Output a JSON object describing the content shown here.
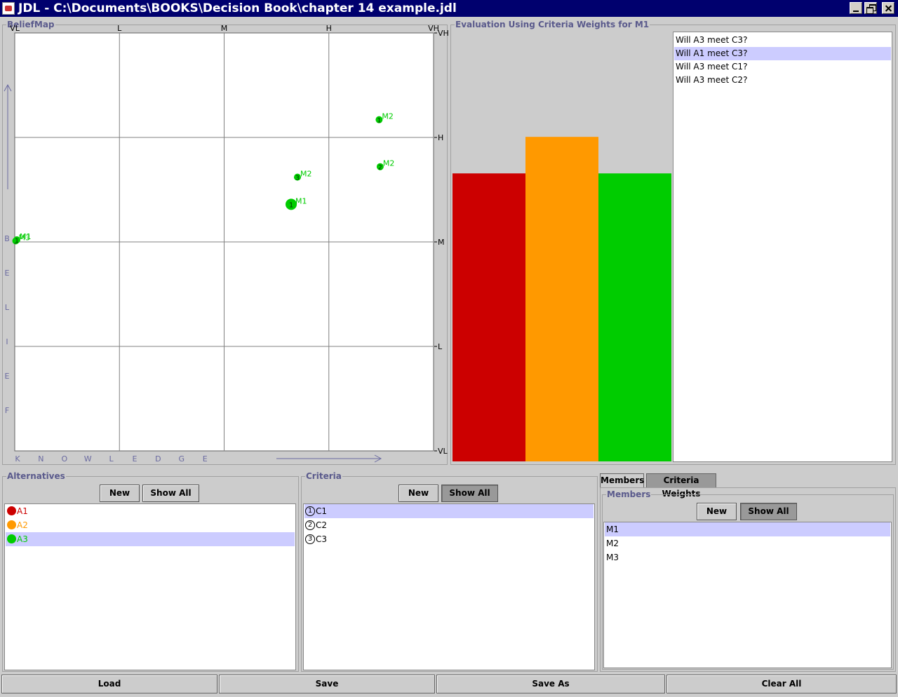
{
  "window": {
    "title": "JDL - C:\\Documents\\BOOKS\\Decision Book\\chapter 14 example.jdl"
  },
  "belief_map": {
    "title": "BeliefMap",
    "x_ticks": [
      "VL",
      "L",
      "M",
      "H",
      "VH"
    ],
    "y_ticks_right": [
      "VH",
      "H",
      "M",
      "L",
      "VL"
    ],
    "x_axis_letters": [
      "K",
      "N",
      "O",
      "W",
      "L",
      "E",
      "D",
      "G",
      "E"
    ],
    "y_axis_letters": [
      "B",
      "E",
      "L",
      "I",
      "E",
      "F"
    ],
    "colors": {
      "point": "#00cc00",
      "grid": "#808080",
      "axis_label": "#6a6aa0"
    },
    "points": [
      {
        "x": 3.48,
        "y": 3.17,
        "criterion": "1",
        "member": "M2"
      },
      {
        "x": 3.49,
        "y": 2.72,
        "criterion": "2",
        "member": "M2"
      },
      {
        "x": 2.7,
        "y": 2.62,
        "criterion": "3",
        "member": "M2"
      },
      {
        "x": 2.64,
        "y": 2.36,
        "criterion": "1",
        "member": "M1"
      },
      {
        "x": 0.01,
        "y": 2.01,
        "criterion": "3",
        "member": "M3"
      },
      {
        "x": 0.02,
        "y": 2.02,
        "criterion": "1",
        "member": "M1"
      }
    ]
  },
  "evaluation": {
    "title": "Evaluation Using Criteria Weights for M1",
    "chart_data": {
      "type": "bar",
      "categories": [
        "A1",
        "A2",
        "A3"
      ],
      "values": [
        0.67,
        0.755,
        0.67
      ],
      "colors": [
        "#cc0000",
        "#ff9900",
        "#00cc00"
      ],
      "ylim": [
        0,
        1
      ]
    },
    "questions": [
      {
        "text": "Will A3 meet C3?",
        "selected": false
      },
      {
        "text": "Will A1 meet C3?",
        "selected": true
      },
      {
        "text": "Will A3 meet C1?",
        "selected": false
      },
      {
        "text": "Will A3 meet C2?",
        "selected": false
      }
    ]
  },
  "alternatives": {
    "title": "Alternatives",
    "new_label": "New",
    "show_all_label": "Show All",
    "items": [
      {
        "label": "A1",
        "color": "#cc0000"
      },
      {
        "label": "A2",
        "color": "#ff9900"
      },
      {
        "label": "A3",
        "color": "#00cc00"
      }
    ]
  },
  "criteria": {
    "title": "Criteria",
    "new_label": "New",
    "show_all_label": "Show All",
    "items": [
      {
        "num": "1",
        "label": "C1"
      },
      {
        "num": "2",
        "label": "C2"
      },
      {
        "num": "3",
        "label": "C3"
      }
    ]
  },
  "tabs": [
    "Members",
    "Criteria Weights"
  ],
  "members": {
    "title": "Members",
    "new_label": "New",
    "show_all_label": "Show All",
    "items": [
      "M1",
      "M2",
      "M3"
    ]
  },
  "footer": {
    "load": "Load",
    "save": "Save",
    "save_as": "Save As",
    "clear_all": "Clear All"
  }
}
